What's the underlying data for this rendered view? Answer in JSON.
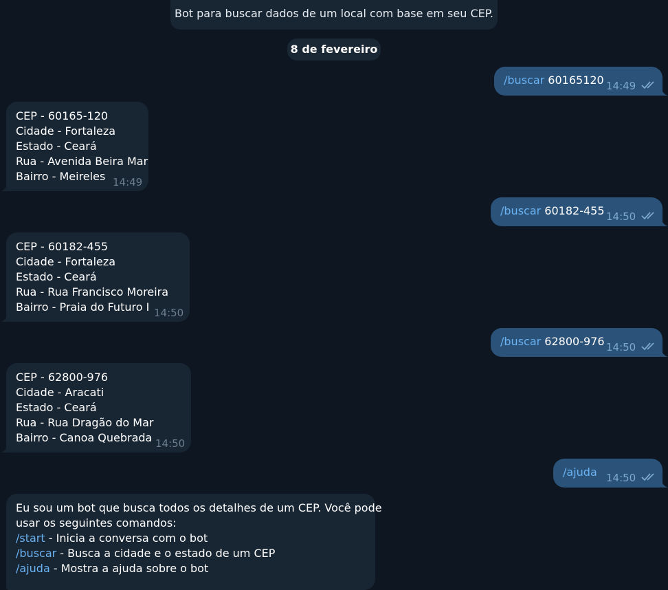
{
  "bot_description": "Bot para buscar dados de um local com base em seu CEP.",
  "date_separator": "8 de fevereiro",
  "outgoing": [
    {
      "command": "/buscar",
      "arg": " 60165120",
      "time": "14:49"
    },
    {
      "command": "/buscar",
      "arg": " 60182-455",
      "time": "14:50"
    },
    {
      "command": "/buscar",
      "arg": " 62800-976",
      "time": "14:50"
    },
    {
      "command": "/ajuda",
      "arg": "",
      "time": "14:50"
    }
  ],
  "incoming": [
    {
      "lines": [
        "CEP - 60165-120",
        "Cidade - Fortaleza",
        "Estado - Ceará",
        "Rua - Avenida Beira Mar",
        "Bairro - Meireles"
      ],
      "time": "14:49"
    },
    {
      "lines": [
        "CEP - 60182-455",
        "Cidade - Fortaleza",
        "Estado - Ceará",
        "Rua - Rua Francisco Moreira",
        "Bairro - Praia do Futuro I"
      ],
      "time": "14:50"
    },
    {
      "lines": [
        "CEP - 62800-976",
        "Cidade - Aracati",
        "Estado - Ceará",
        "Rua - Rua Dragão do Mar",
        "Bairro - Canoa Quebrada"
      ],
      "time": "14:50"
    }
  ],
  "help_message": {
    "intro_1": "Eu sou um bot que busca todos os detalhes de um CEP. Você pode",
    "intro_2": "usar os seguintes comandos:",
    "commands": [
      {
        "command": "/start",
        "desc": " - Inicia a conversa com o bot"
      },
      {
        "command": "/buscar",
        "desc": " - Busca a cidade e o estado de um CEP"
      },
      {
        "command": "/ajuda",
        "desc": " - Mostra a ajuda sobre o bot"
      }
    ]
  },
  "colors": {
    "background": "#0e1621",
    "incoming_bubble": "#182533",
    "outgoing_bubble": "#2b5278",
    "command_link": "#6ab2f2"
  }
}
